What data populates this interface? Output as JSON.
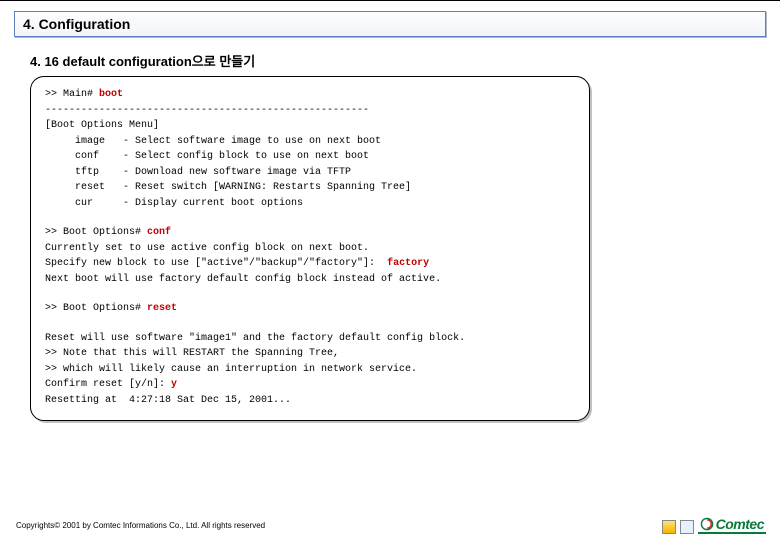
{
  "section_title": "4. Configuration",
  "subheading": "4. 16 default configuration으로 만들기",
  "term": {
    "l1_prompt": ">> Main# ",
    "l1_cmd": "boot",
    "sep": "------------------------------------------------------",
    "menu_title": "[Boot Options Menu]",
    "m1": "     image   - Select software image to use on next boot",
    "m2": "     conf    - Select config block to use on next boot",
    "m3": "     tftp    - Download new software image via TFTP",
    "m4": "     reset   - Reset switch [WARNING: Restarts Spanning Tree]",
    "m5": "     cur     - Display current boot options",
    "l2_prompt": ">> Boot Options# ",
    "l2_cmd": "conf",
    "l3": "Currently set to use active config block on next boot.",
    "l4_a": "Specify new block to use [\"active\"/\"backup\"/\"factory\"]:  ",
    "l4_cmd": "factory",
    "l5": "Next boot will use factory default config block instead of active.",
    "l6_prompt": ">> Boot Options# ",
    "l6_cmd": "reset",
    "l7": "Reset will use software \"image1\" and the factory default config block.",
    "l8": ">> Note that this will RESTART the Spanning Tree,",
    "l9": ">> which will likely cause an interruption in network service.",
    "l10_a": "Confirm reset [y/n]: ",
    "l10_cmd": "y",
    "l11": "Resetting at  4:27:18 Sat Dec 15, 2001..."
  },
  "footer": "Copyrights© 2001 by Comtec Informations Co., Ltd. All rights reserved",
  "logo": {
    "name": "Comtec"
  }
}
